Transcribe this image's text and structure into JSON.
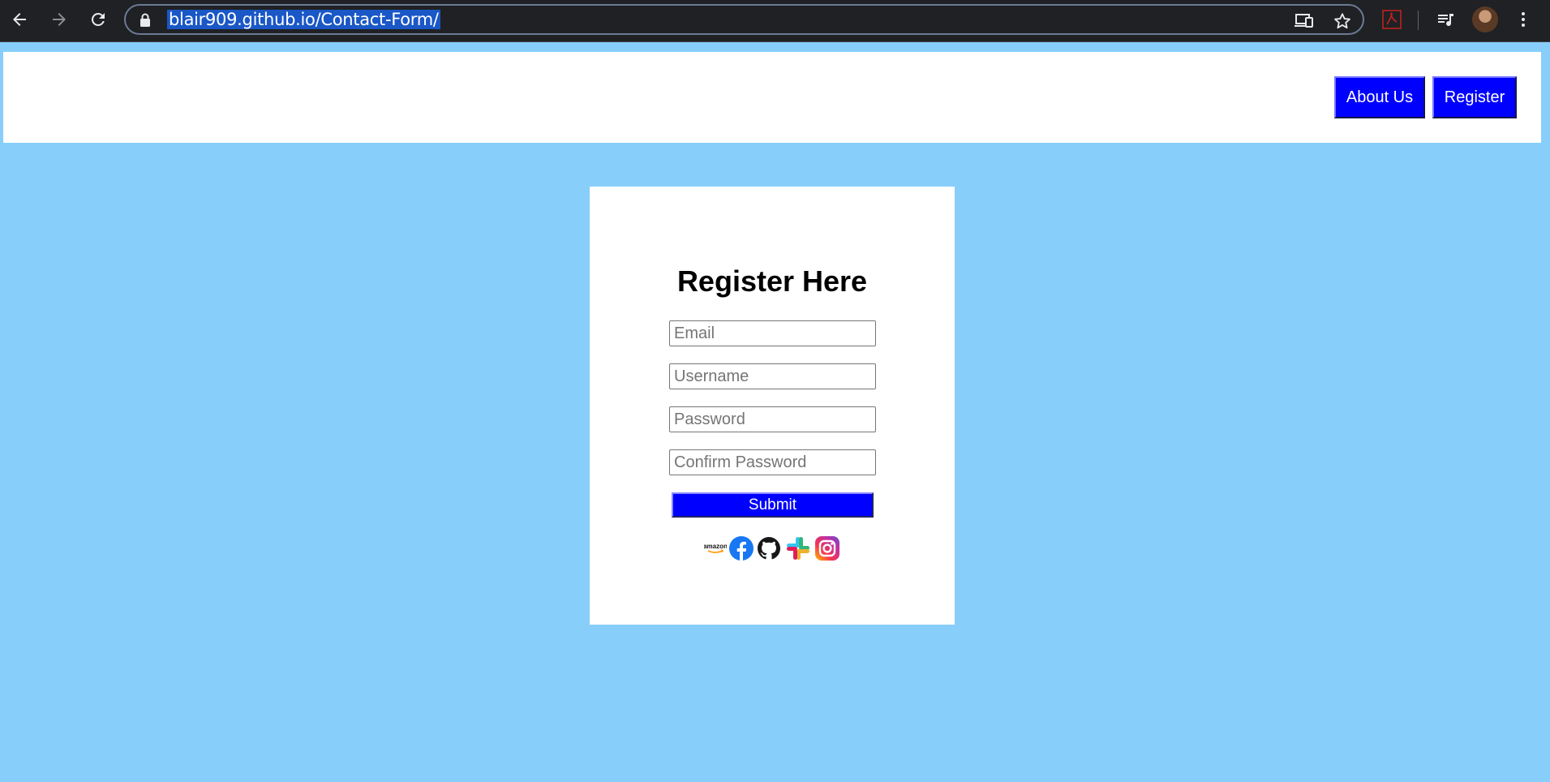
{
  "browser": {
    "url": "blair909.github.io/Contact-Form/",
    "icons": [
      "back-icon",
      "forward-icon",
      "reload-icon",
      "lock-icon",
      "cast-icon",
      "bookmark-star-icon",
      "pdf-extension-icon",
      "media-queue-icon",
      "profile-avatar",
      "more-menu-icon"
    ]
  },
  "nav": {
    "about_label": "About Us",
    "register_label": "Register"
  },
  "form": {
    "title": "Register Here",
    "email_placeholder": "Email",
    "username_placeholder": "Username",
    "password_placeholder": "Password",
    "confirm_placeholder": "Confirm Password",
    "submit_label": "Submit",
    "social_icons": [
      "amazon-icon",
      "facebook-icon",
      "github-icon",
      "slack-icon",
      "instagram-icon"
    ],
    "amazon_logo_text": "amazon"
  },
  "colors": {
    "page_bg": "#87cefa",
    "button_bg": "#0000ff",
    "chrome_bg": "#202124",
    "url_highlight": "#1a57c7"
  }
}
